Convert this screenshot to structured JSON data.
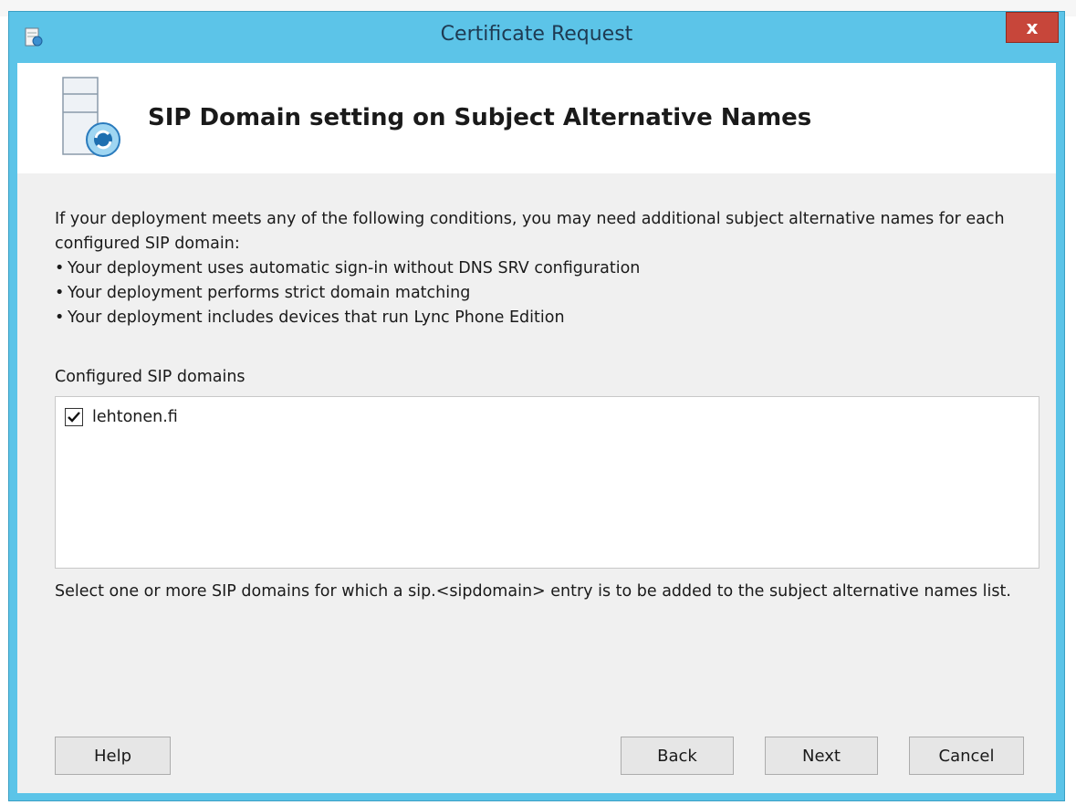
{
  "window": {
    "title": "Certificate Request",
    "close_label": "x"
  },
  "header": {
    "title": "SIP Domain setting on Subject Alternative Names"
  },
  "description": {
    "intro": "If your deployment meets any of the following conditions, you may need additional subject alternative names for each configured SIP domain:",
    "bullets": [
      "Your deployment uses automatic sign-in without DNS SRV configuration",
      "Your deployment performs strict domain matching",
      "Your deployment includes devices that run Lync Phone Edition"
    ]
  },
  "domains": {
    "label": "Configured SIP domains",
    "items": [
      {
        "name": "lehtonen.fi",
        "checked": true
      }
    ]
  },
  "hint": "Select one or more SIP domains for which a sip.<sipdomain> entry is to be added to the subject alternative names list.",
  "buttons": {
    "help": "Help",
    "back": "Back",
    "next": "Next",
    "cancel": "Cancel"
  },
  "colors": {
    "titlebar": "#5cc4e8",
    "close": "#c7463a",
    "client": "#f0f0f0"
  },
  "icons": [
    "app-icon",
    "certificate-server-icon",
    "checkmark-icon",
    "close-icon"
  ]
}
